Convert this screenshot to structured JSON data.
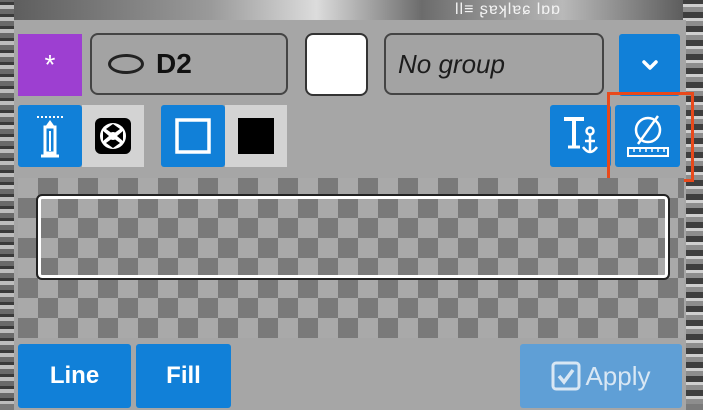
{
  "background": {
    "top_text": "ll≡ ʂɐʞlɐɕ lɒɒ"
  },
  "toolbar": {
    "star_label": "*",
    "shape_name": "D2",
    "group_text": "No group",
    "swatch_color": "#ffffff"
  },
  "preview": {
    "border_color": "#ffffff"
  },
  "actions": {
    "line_label": "Line",
    "fill_label": "Fill",
    "apply_label": "Apply"
  },
  "colors": {
    "accent_blue": "#1180d8",
    "star_purple": "#9d3fd1",
    "panel_gray": "#a6a6a6",
    "highlight": "#e8491b"
  },
  "icons": [
    "ellipse-shape-icon",
    "chevron-down-icon",
    "pen-icon",
    "aperture-icon",
    "outline-square-icon",
    "filled-square-icon",
    "text-anchor-icon",
    "diameter-ruler-icon",
    "checkbox-icon"
  ]
}
